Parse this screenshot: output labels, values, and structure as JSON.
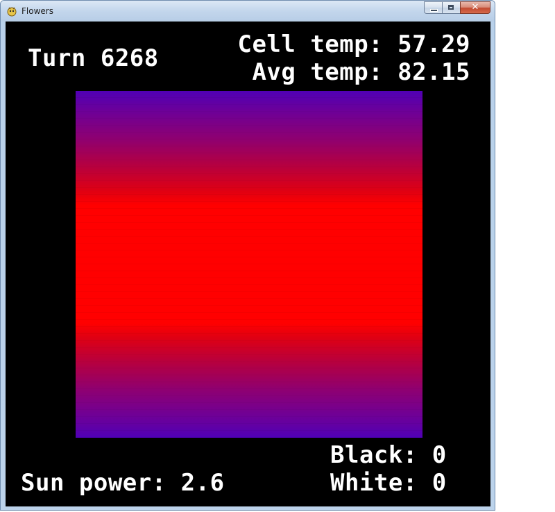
{
  "window": {
    "title": "Flowers",
    "icon": "pygame-snake-icon",
    "caption_buttons": {
      "minimize": "minimize-icon",
      "maximize": "maximize-icon",
      "close": "close-icon"
    }
  },
  "hud": {
    "turn": "Turn 6268",
    "cell_temp": "Cell temp: 57.29",
    "avg_temp": "Avg temp: 82.15",
    "black": "Black: 0",
    "white": "White: 0",
    "sun_power": "Sun power: 2.6"
  },
  "colors": {
    "background": "#000000",
    "text": "#ffffff",
    "hot": "#ff0000",
    "cool": "#5000b5"
  }
}
